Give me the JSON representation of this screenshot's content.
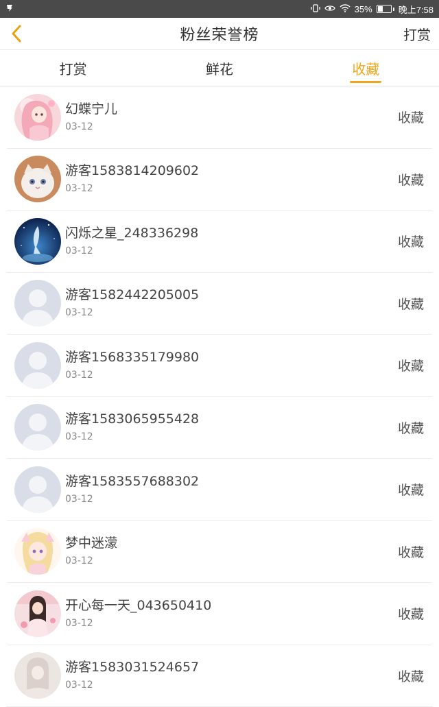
{
  "status_bar": {
    "battery": "35%",
    "time": "晚上7:58",
    "icons": [
      "app-notification-icon",
      "vibrate-icon",
      "eye-icon",
      "wifi-icon",
      "battery-icon"
    ]
  },
  "header": {
    "title": "粉丝荣誉榜",
    "right_label": "打赏",
    "back_icon": "chevron-left-icon"
  },
  "tabs": [
    {
      "label": "打赏",
      "active": false
    },
    {
      "label": "鲜花",
      "active": false
    },
    {
      "label": "收藏",
      "active": true
    }
  ],
  "colors": {
    "accent": "#f2a51a",
    "divider": "#ededed",
    "status_bar": "#4a4a4a"
  },
  "list": [
    {
      "name": "幻蝶宁儿",
      "date": "03-12",
      "action": "收藏",
      "avatar": "anime-pink"
    },
    {
      "name": "游客1583814209602",
      "date": "03-12",
      "action": "收藏",
      "avatar": "kitten"
    },
    {
      "name": "闪烁之星_248336298",
      "date": "03-12",
      "action": "收藏",
      "avatar": "night-sky"
    },
    {
      "name": "游客1582442205005",
      "date": "03-12",
      "action": "收藏",
      "avatar": "default"
    },
    {
      "name": "游客1568335179980",
      "date": "03-12",
      "action": "收藏",
      "avatar": "default"
    },
    {
      "name": "游客1583065955428",
      "date": "03-12",
      "action": "收藏",
      "avatar": "default"
    },
    {
      "name": "游客1583557688302",
      "date": "03-12",
      "action": "收藏",
      "avatar": "default"
    },
    {
      "name": "梦中迷濛",
      "date": "03-12",
      "action": "收藏",
      "avatar": "anime-blonde"
    },
    {
      "name": "开心每一天_043650410",
      "date": "03-12",
      "action": "收藏",
      "avatar": "girl-photo"
    },
    {
      "name": "游客1583031524657",
      "date": "03-12",
      "action": "收藏",
      "avatar": "pale-photo"
    }
  ]
}
